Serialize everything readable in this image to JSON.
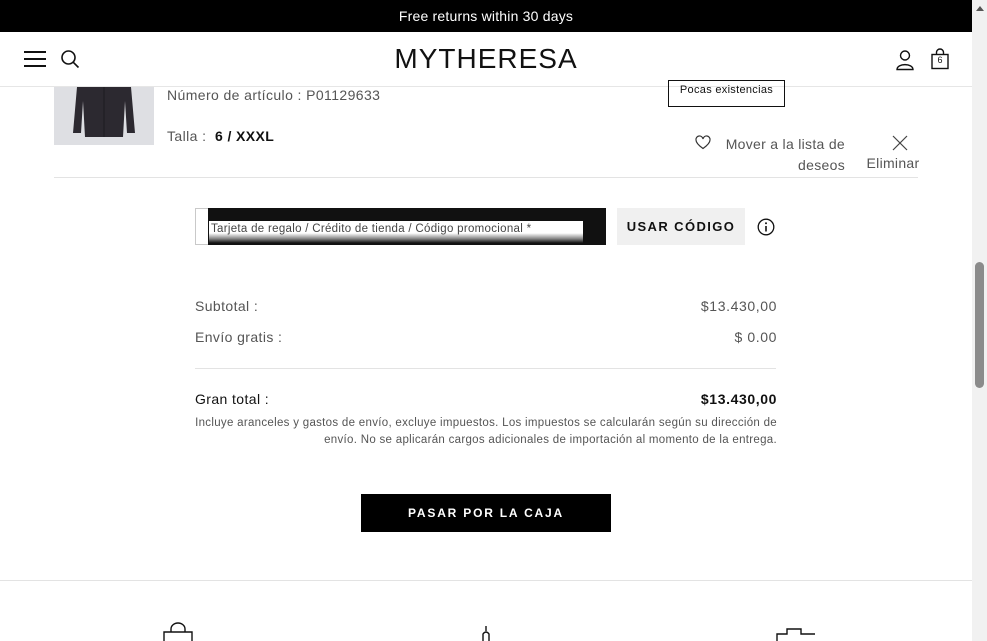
{
  "promo_bar": {
    "text": "Free returns within 30 days"
  },
  "header": {
    "logo": "MYTHERESA",
    "bag_count": "6"
  },
  "item": {
    "item_number": "Número de artículo : P01129633",
    "size_label": "Talla :",
    "size_value": "6 / XXXL",
    "stock_badge": "Pocas existencias",
    "wishlist_label": "Mover a la lista de deseos",
    "remove_label": "Eliminar"
  },
  "promo": {
    "placeholder": "Tarjeta de regalo / Crédito de tienda / Código promocional *",
    "button_label": "USAR CÓDIGO"
  },
  "summary": {
    "subtotal_label": "Subtotal :",
    "subtotal_value": "$13.430,00",
    "shipping_label": "Envío gratis :",
    "shipping_value": "$ 0.00",
    "total_label": "Gran total :",
    "total_value": "$13.430,00",
    "tax_note": "Incluye aranceles y gastos de envío, excluye impuestos. Los impuestos se calcularán según su dirección de envío. No se aplicarán cargos adicionales de importación al momento de la entrega."
  },
  "checkout": {
    "label": "PASAR POR LA CAJA"
  },
  "icons": {
    "menu": "hamburger-icon",
    "search": "search-icon",
    "account": "user-icon",
    "bag": "shopping-bag-icon",
    "wishlist": "heart-icon",
    "remove": "close-icon",
    "info": "info-icon"
  },
  "colors": {
    "primary": "#000000",
    "button_secondary": "#f0f0f0"
  }
}
